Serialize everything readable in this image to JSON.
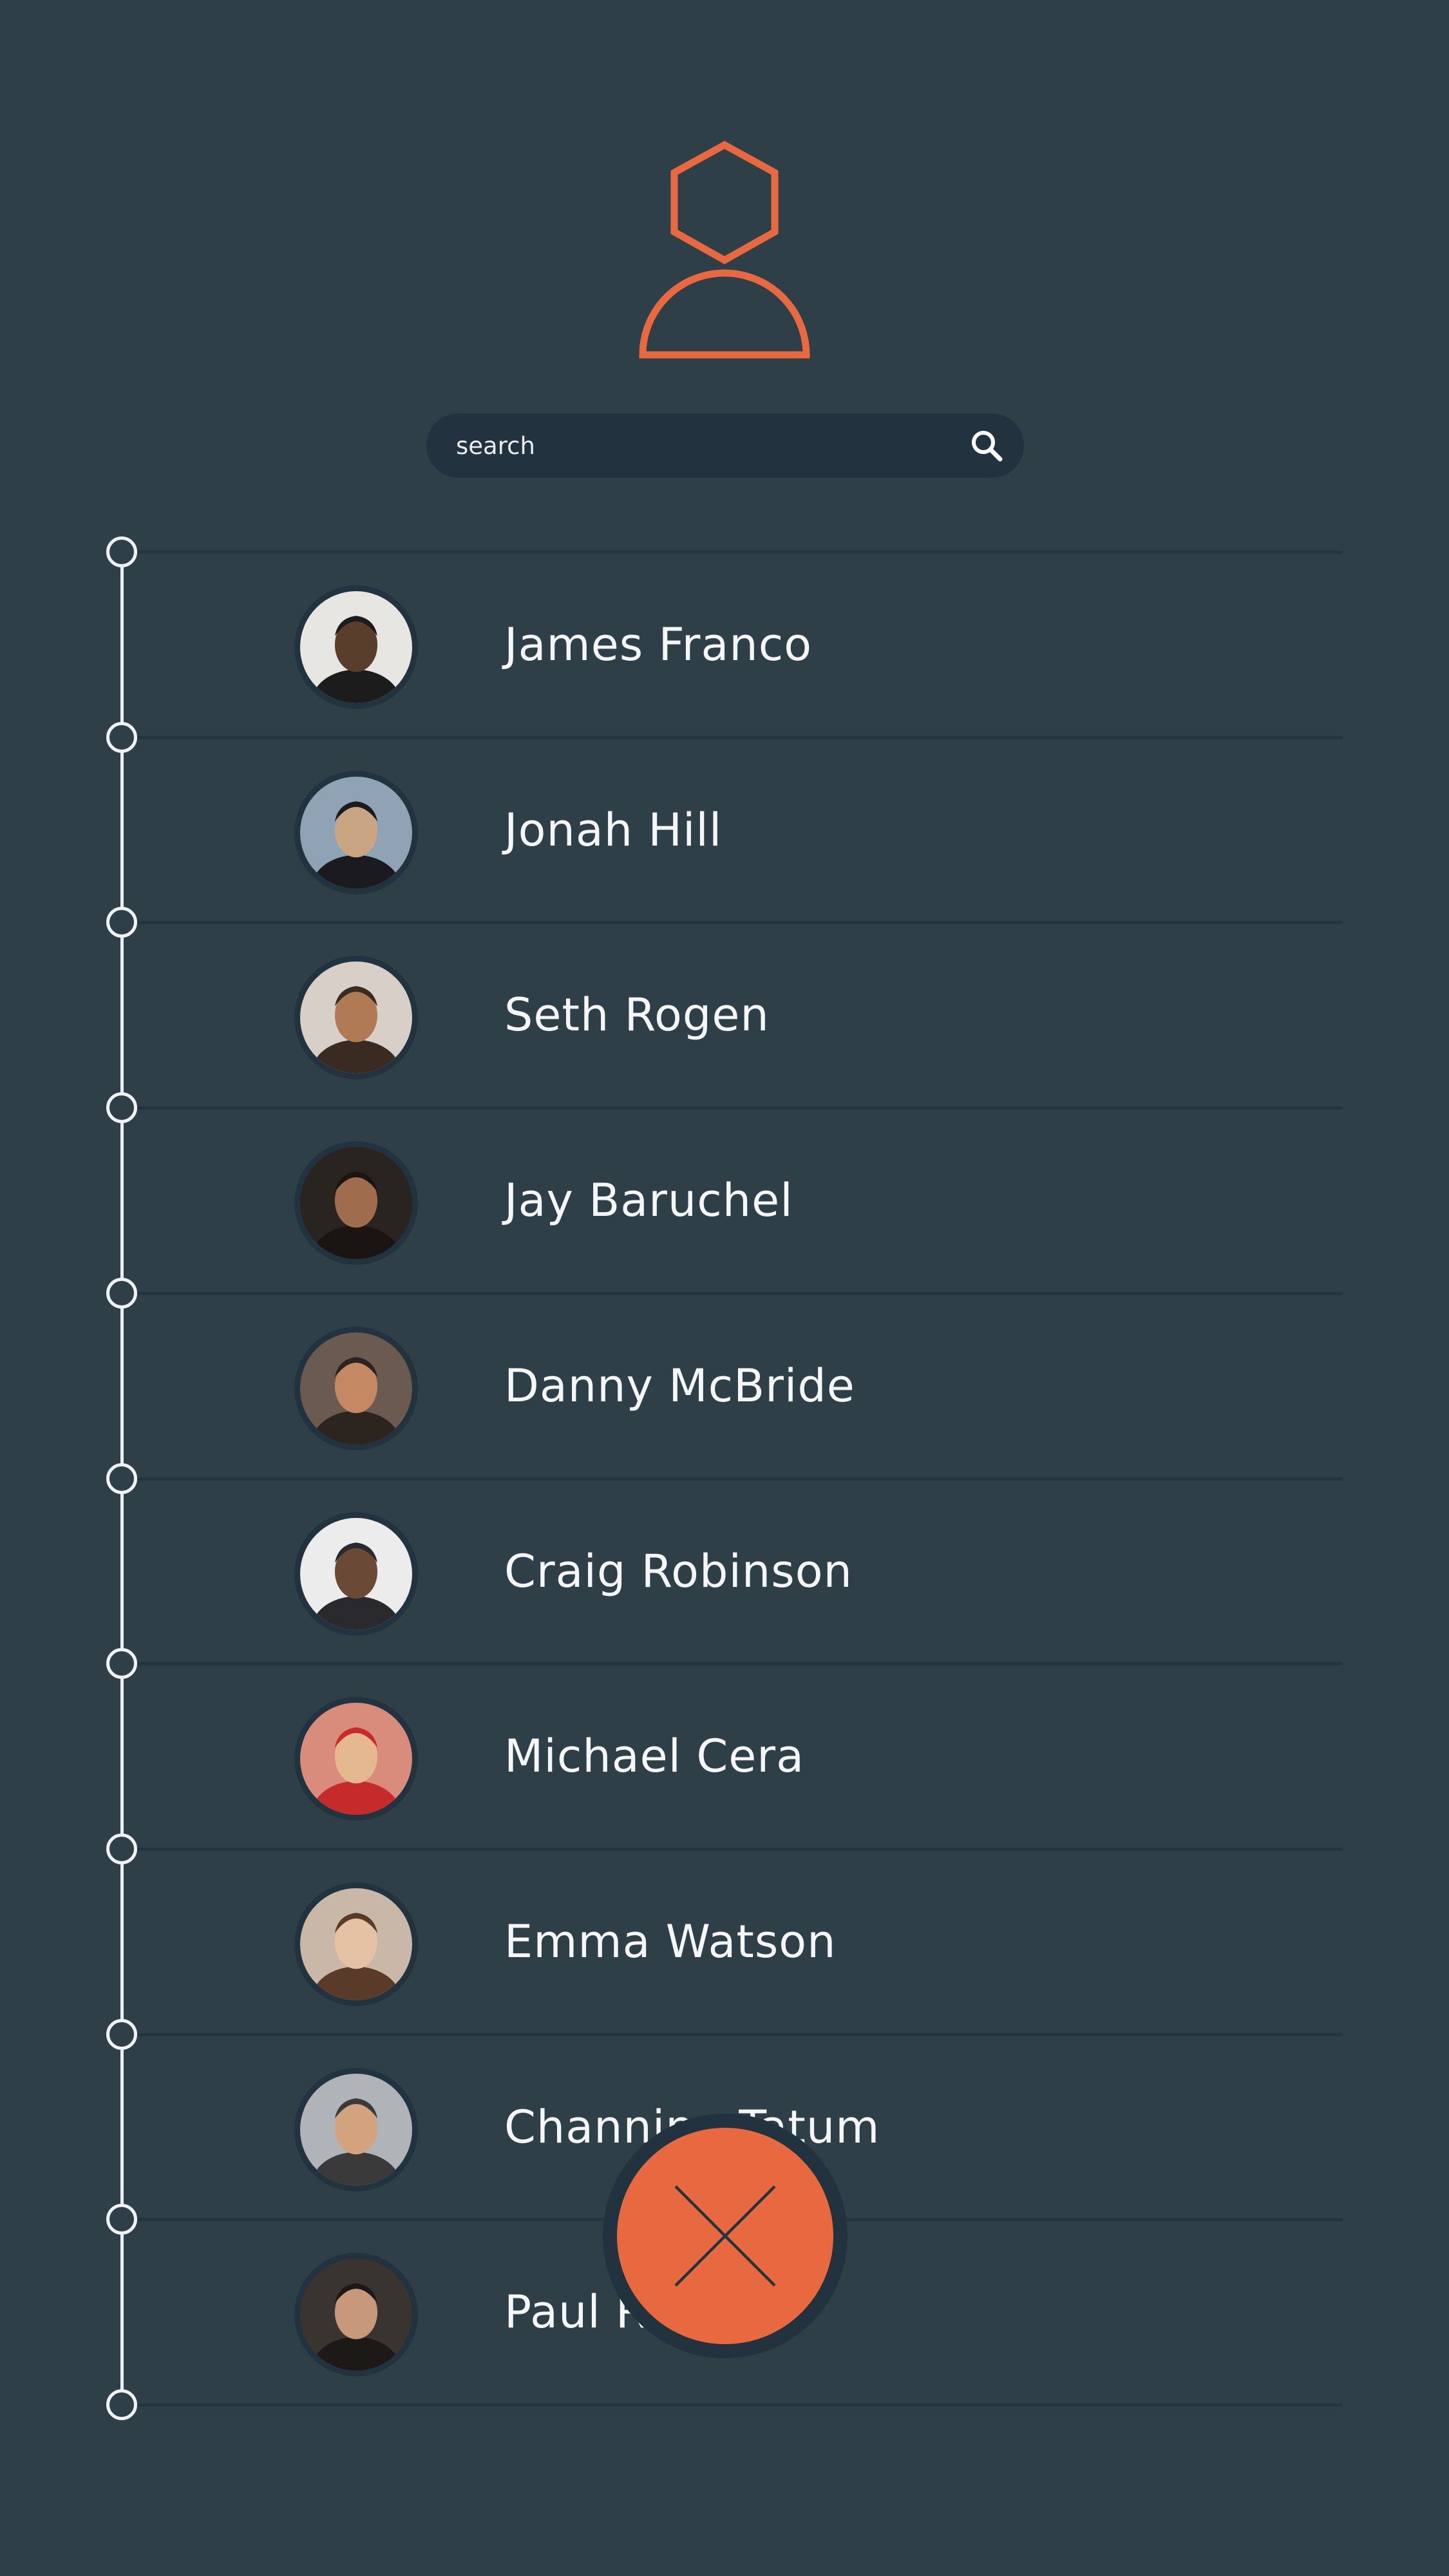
{
  "theme": {
    "background": "#2f3f48",
    "accent": "#e8683f",
    "line": "#243440",
    "timeline": "#e9eef0",
    "search_bg": "#22323f"
  },
  "header": {
    "logo_icon": "user-icon"
  },
  "search": {
    "placeholder": "search",
    "value": "",
    "icon": "search-icon"
  },
  "contacts": [
    {
      "name": "James Franco"
    },
    {
      "name": "Jonah Hill"
    },
    {
      "name": "Seth Rogen"
    },
    {
      "name": "Jay Baruchel"
    },
    {
      "name": "Danny McBride"
    },
    {
      "name": "Craig Robinson"
    },
    {
      "name": "Michael Cera"
    },
    {
      "name": "Emma Watson"
    },
    {
      "name": "Channing Tatum"
    },
    {
      "name": "Paul Rudd"
    }
  ],
  "fab": {
    "icon": "close-icon"
  }
}
